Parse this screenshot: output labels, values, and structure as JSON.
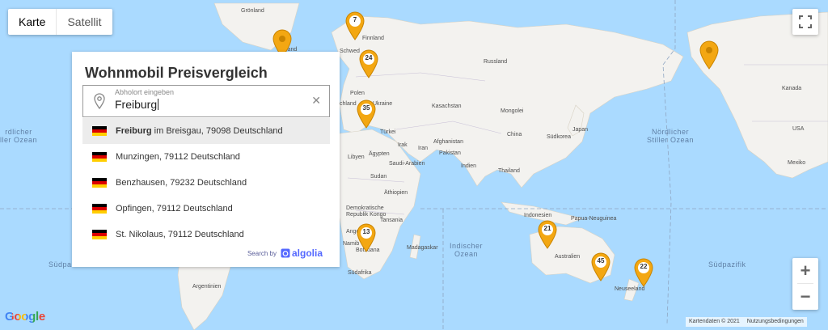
{
  "map_type_control": {
    "karte": "Karte",
    "satellit": "Satellit",
    "selected": "Karte"
  },
  "panel": {
    "title": "Wohnmobil Preisvergleich",
    "search": {
      "label": "Abholort eingeben",
      "value": "Freiburg"
    },
    "suggestions": [
      {
        "match": "Freiburg",
        "rest": " im Breisgau, 79098 Deutschland",
        "active": true
      },
      {
        "match": "",
        "rest": "Munzingen, 79112 Deutschland",
        "active": false
      },
      {
        "match": "",
        "rest": "Benzhausen, 79232 Deutschland",
        "active": false
      },
      {
        "match": "",
        "rest": "Opfingen, 79112 Deutschland",
        "active": false
      },
      {
        "match": "",
        "rest": "St. Nikolaus, 79112 Deutschland",
        "active": false
      }
    ],
    "powered_by": "Search by",
    "powered_brand": "algolia"
  },
  "markers": [
    {
      "count": "7"
    },
    {
      "count": ""
    },
    {
      "count": "24"
    },
    {
      "count": "35"
    },
    {
      "count": ""
    },
    {
      "count": "13"
    },
    {
      "count": "21"
    },
    {
      "count": "45"
    },
    {
      "count": "22"
    }
  ],
  "map_labels": {
    "groenland": "Grönland",
    "finnland": "Finnland",
    "schwed": "Schwed",
    "russland": "Russland",
    "polen": "Polen",
    "ukraine": "Ukraine",
    "chland": "chland",
    "kasachstan": "Kasachstan",
    "mongolei": "Mongolei",
    "tuerkei": "Türkei",
    "china": "China",
    "japan": "Japan",
    "suedkorea": "Südkorea",
    "irak": "Irak",
    "iran": "Iran",
    "afghanistan": "Afghanistan",
    "pakistan": "Pakistan",
    "libyen": "Libyen",
    "aegypten": "Ägypten",
    "saudi": "Saudi-Arabien",
    "indien": "Indien",
    "thailand": "Thailand",
    "sudan": "Sudan",
    "aethiopien": "Äthiopien",
    "drk1": "Demokratische",
    "drk2": "Republik Kongo",
    "tansania": "Tansania",
    "indonesien": "Indonesien",
    "papua": "Papua-Neuguinea",
    "ango": "Ango",
    "namib": "Namib",
    "madagaskar": "Madagaskar",
    "botsuana": "Botsuana",
    "australien": "Australien",
    "suedafrika": "Südafrika",
    "neuseeland": "Neuseeland",
    "argentinien": "Argentinien",
    "kanada": "Kanada",
    "usa": "USA",
    "mexiko": "Mexiko",
    "land": "land",
    "ocean_nw": "rdlicher\nller Ozean",
    "ocean_ne": "Nördlicher\nStiller Ozean",
    "ocean_in": "Indischer\nOzean",
    "ocean_sw": "Südpaz",
    "ocean_se": "Südpazifik"
  },
  "google_logo": "Google",
  "footer": {
    "kartendaten": "Kartendaten © 2021",
    "nutzung": "Nutzungsbedingungen"
  },
  "colors": {
    "water": "#aadaff",
    "land": "#f3f2ef",
    "marker": "#f3a712",
    "german_flag": [
      "#000000",
      "#dd0000",
      "#ffce00"
    ]
  }
}
